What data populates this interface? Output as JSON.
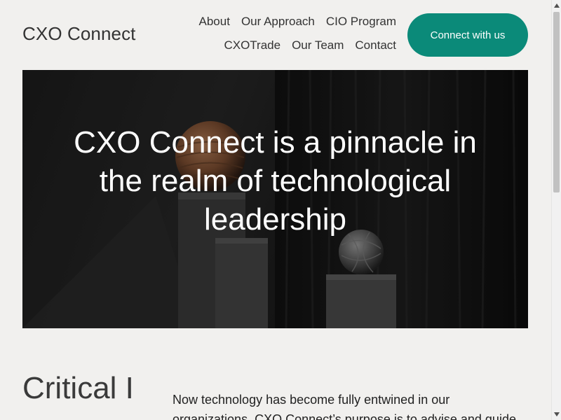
{
  "header": {
    "logo": "CXO Connect",
    "nav_row1": [
      "About",
      "Our Approach",
      "CIO Program"
    ],
    "nav_row2": [
      "CXOTrade",
      "Our Team",
      "Contact"
    ],
    "cta_label": "Connect with us"
  },
  "hero": {
    "title": "CXO Connect is a pinnacle in the realm of technological leadership"
  },
  "section": {
    "heading": "Critical I",
    "body": "Now technology has become fully entwined in our organizations, CXO Connect’s purpose is to advise and guide"
  },
  "colors": {
    "accent": "#0b8a79",
    "background": "#f1f0ee",
    "text": "#333333"
  },
  "icons": {
    "scroll_up": "triangle-up-icon",
    "scroll_down": "triangle-down-icon"
  }
}
